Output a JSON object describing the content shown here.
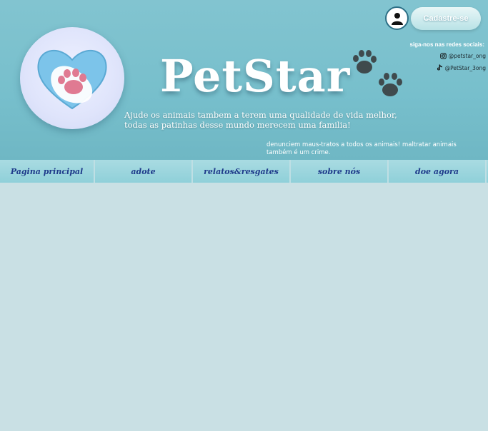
{
  "header": {
    "brand": "PetStar",
    "tagline_line1": "Ajude os animais tambem a terem uma qualidade de vida melhor,",
    "tagline_line2": "todas as patinhas desse mundo merecem uma familia!",
    "warning": "denunciem maus-tratos a todos os animais! maltratar animais também é um crime.",
    "signup_label": "Cadastre-se",
    "social_title": "siga-nos nas redes sociais:",
    "instagram_handle": "@petstar_ong",
    "tiktok_handle": "@PetStar_3ong"
  },
  "nav": {
    "items": [
      {
        "label": "Pagina principal"
      },
      {
        "label": "adote"
      },
      {
        "label": "relatos&resgates"
      },
      {
        "label": "sobre nós"
      },
      {
        "label": "doe agora"
      }
    ]
  },
  "icons": [
    "paw-heart-logo-icon",
    "paw-prints-icon",
    "user-icon",
    "instagram-icon",
    "tiktok-icon"
  ],
  "colors": {
    "header_bg": "#77bfcc",
    "nav_bg": "#8fd0d9",
    "nav_text": "#1e3a8a",
    "page_bg": "#c9e0e4",
    "heart": "#7cc4ea",
    "paw_pink": "#e07a92"
  }
}
